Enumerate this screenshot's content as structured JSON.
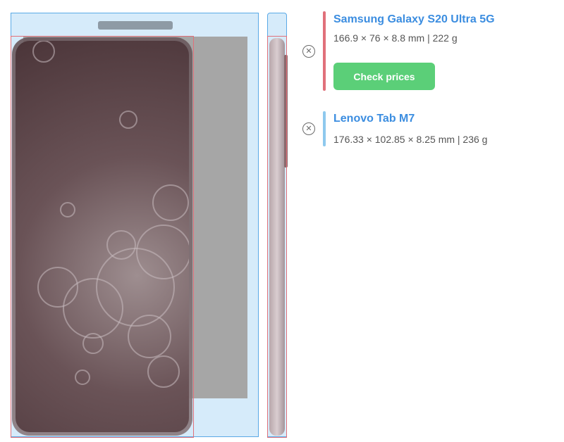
{
  "devices": [
    {
      "name": "Samsung Galaxy S20 Ultra 5G",
      "specs": "166.9 × 76 × 8.8 mm | 222 g",
      "accent": "#e0707a",
      "remove_icon": "circle-x-icon",
      "action_label": "Check prices"
    },
    {
      "name": "Lenovo Tab M7",
      "specs": "176.33 × 102.85 × 8.25 mm | 236 g",
      "accent": "#8ec9ee",
      "remove_icon": "circle-x-icon"
    }
  ],
  "colors": {
    "tablet_fill": "#d6ebfa",
    "tablet_outline": "#5aa9e6",
    "phone_outline": "#e0707a",
    "link": "#3b8de0",
    "button": "#5bcf78"
  }
}
